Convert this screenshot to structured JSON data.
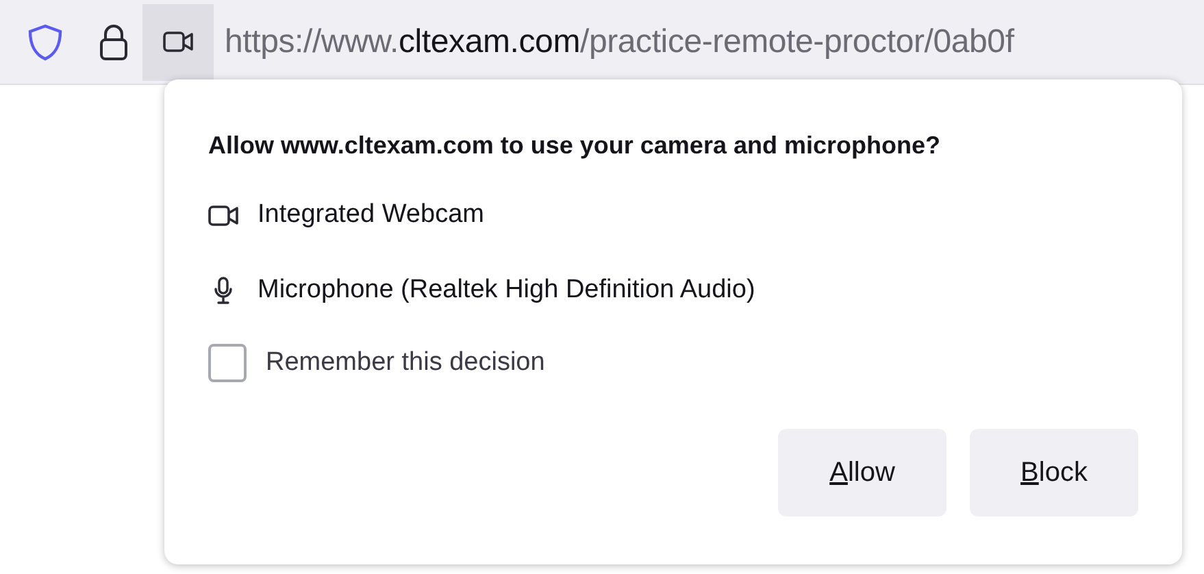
{
  "address_bar": {
    "url_prefix": "https://www.",
    "url_domain": "cltexam.com",
    "url_path": "/practice-remote-proctor/0ab0f",
    "camera_permission_active": true
  },
  "popup": {
    "question": "Allow www.cltexam.com to use your camera and microphone?",
    "devices": [
      {
        "kind": "camera",
        "label": "Integrated Webcam"
      },
      {
        "kind": "microphone",
        "label": "Microphone (Realtek High Definition Audio)"
      }
    ],
    "remember": {
      "label": "Remember this decision",
      "checked": false
    },
    "buttons": [
      {
        "label": "Allow"
      },
      {
        "label": "Block"
      }
    ]
  }
}
